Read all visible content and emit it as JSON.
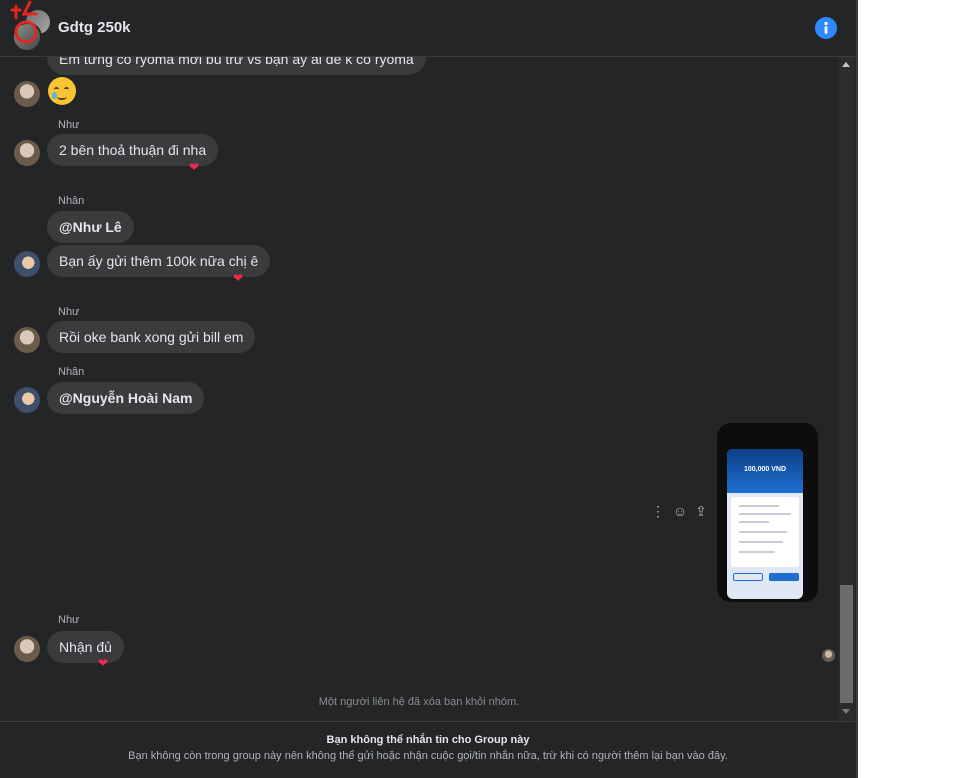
{
  "header": {
    "title": "Gdtg 250k"
  },
  "messages": {
    "m0_text": "Em từng có ryoma mới bù trừ vs bạn ấy ai dè k có ryoma",
    "m1_sender": "Như",
    "m1_text": "2 bên thoả thuận đi nha",
    "m2_sender": "Nhân",
    "m2_text": "@Như Lê",
    "m3_text": "Bạn ấy gửi thêm 100k nữa chị ê",
    "m4_sender": "Như",
    "m4_text": "Rồi oke bank xong gửi bill em",
    "m5_sender": "Nhân",
    "m5_text": "@Nguyễn Hoài Nam",
    "image_amount": "100,000 VND",
    "m6_sender": "Như",
    "m6_text": "Nhận đủ",
    "heart": "❤"
  },
  "system_notice": "Một người liên hệ đã xóa bạn khỏi nhóm.",
  "footer": {
    "title": "Bạn không thể nhắn tin cho Group này",
    "detail": "Bạn không còn trong group này nên không thể gửi hoặc nhận cuộc gọi/tin nhắn nữa, trừ khi có người thêm lại bạn vào đây."
  },
  "icons": {
    "more": "⋮",
    "react": "☺",
    "share": "⇪"
  },
  "colors": {
    "background": "#242526",
    "bubble": "#3a3b3c",
    "accent": "#2e89ff",
    "heart": "#f02849"
  }
}
